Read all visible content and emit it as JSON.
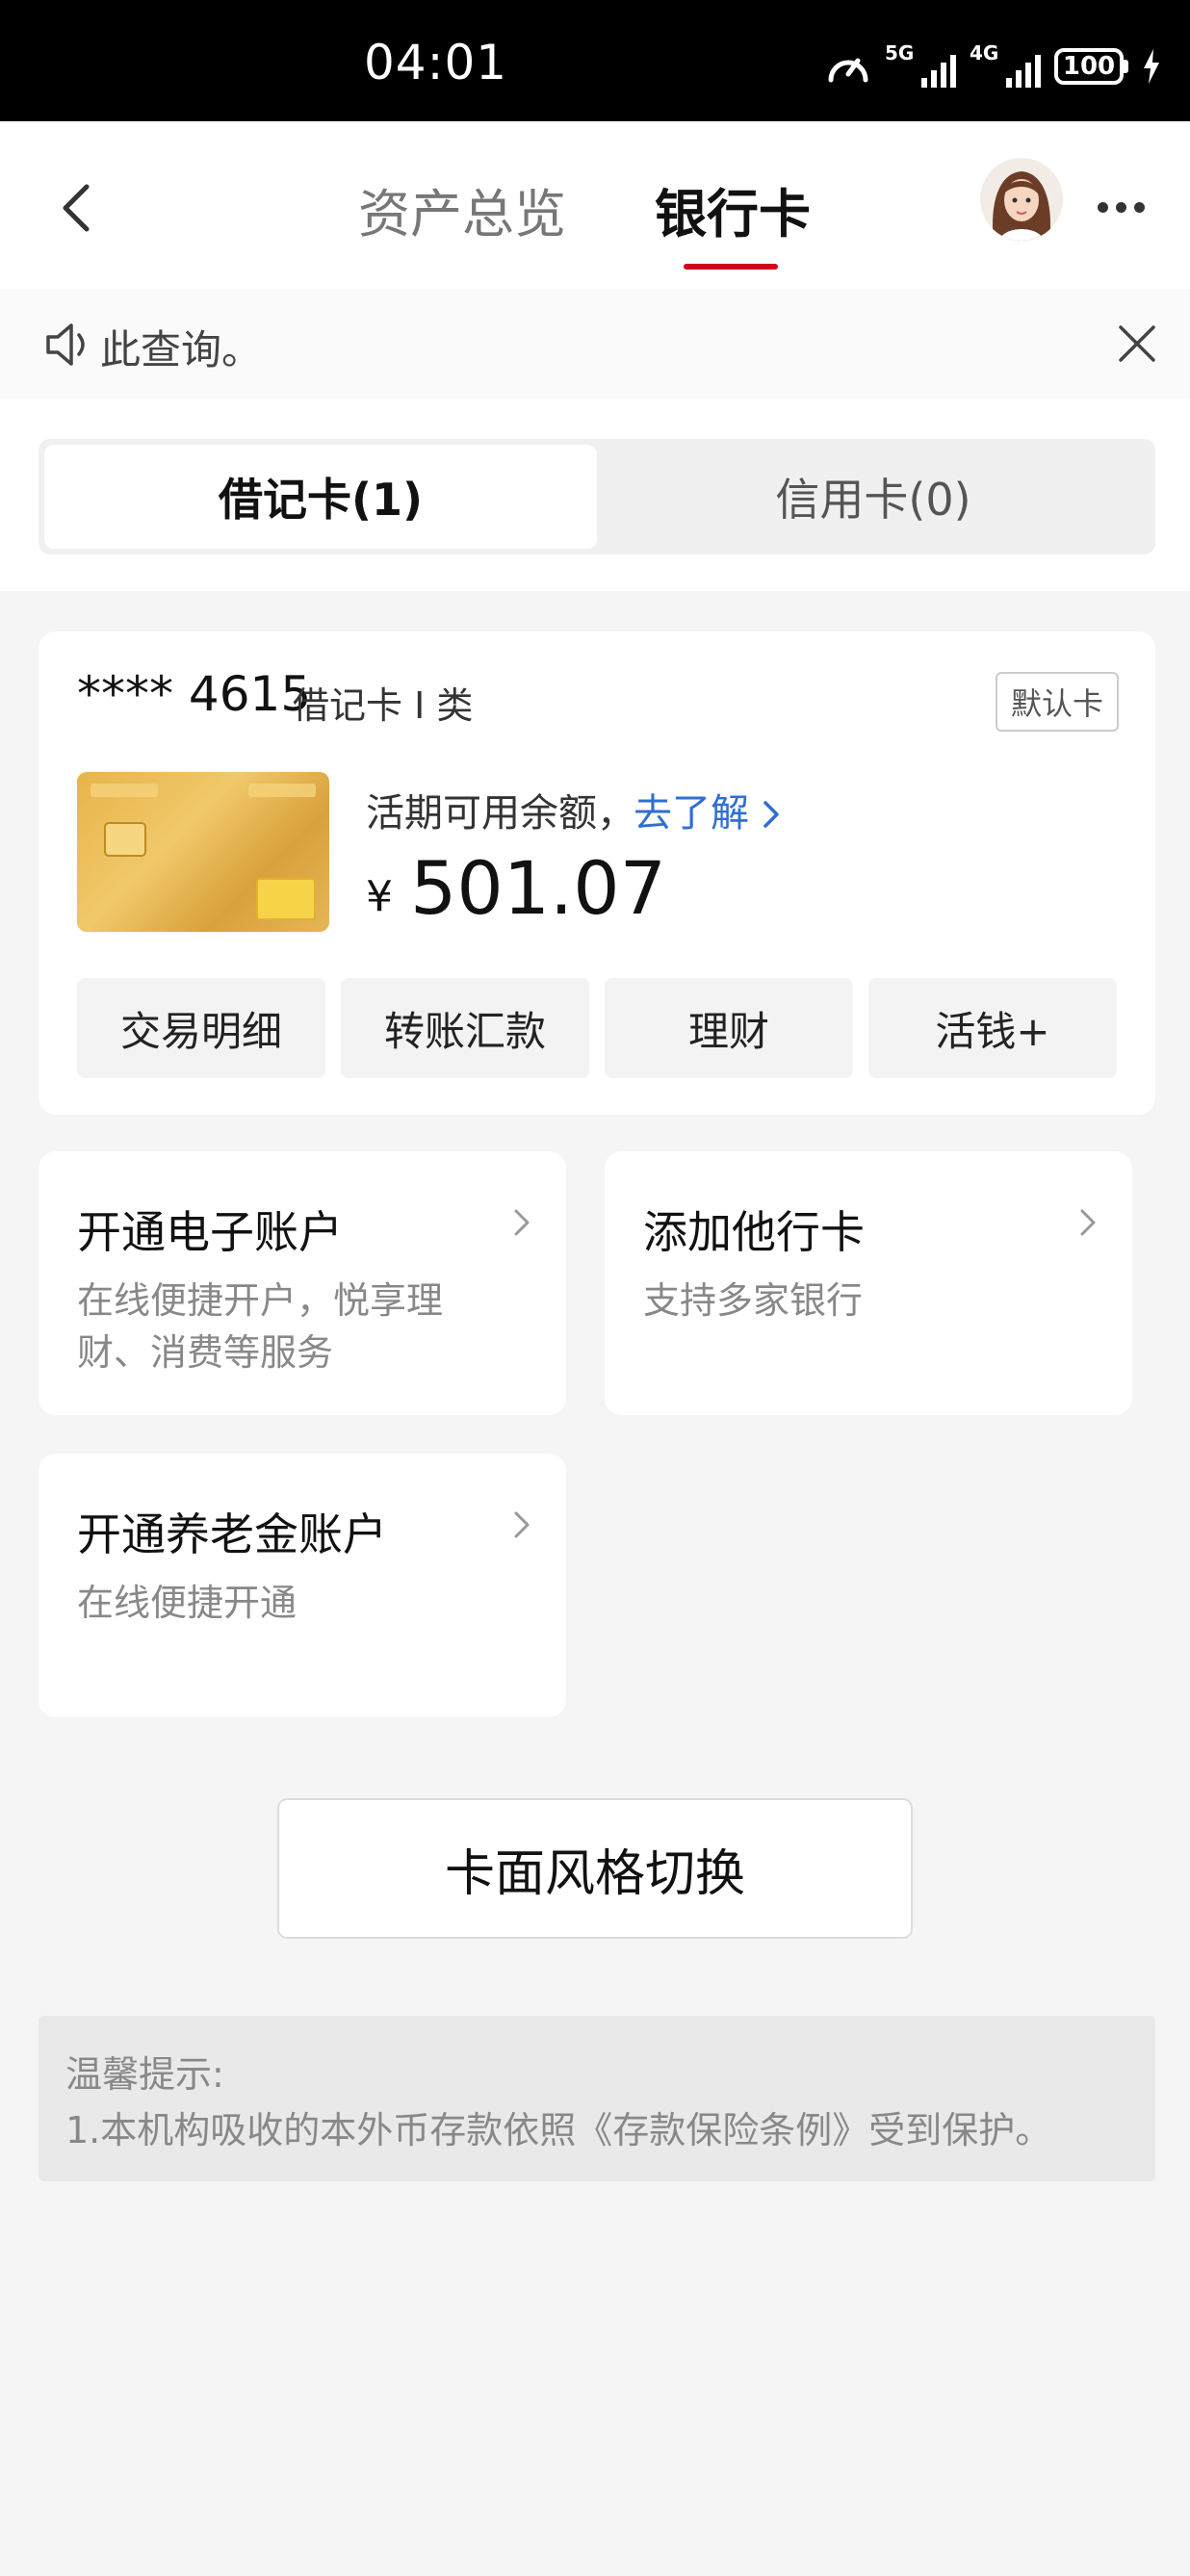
{
  "status_bar": {
    "time": "04:01",
    "sim1": "5G",
    "sim2": "4G",
    "battery": "100"
  },
  "header": {
    "tab_assets": "资产总览",
    "tab_bank": "银行卡",
    "accent": "#d0021b"
  },
  "notice": {
    "text": "此查询。"
  },
  "card_types": {
    "debit": "借记卡(1)",
    "credit": "信用卡(0)"
  },
  "card": {
    "number": "**** 4615",
    "type": "借记卡 I 类",
    "default_badge": "默认卡",
    "balance_label": "活期可用余额，",
    "learn_more": "去了解",
    "currency": "¥",
    "amount": "501.07",
    "actions": [
      "交易明细",
      "转账汇款",
      "理财",
      "活钱+"
    ]
  },
  "tiles": {
    "e_account": {
      "title": "开通电子账户",
      "sub": "在线便捷开户，悦享理财、消费等服务"
    },
    "add_card": {
      "title": "添加他行卡",
      "sub": "支持多家银行"
    },
    "pension": {
      "title": "开通养老金账户",
      "sub": "在线便捷开通"
    }
  },
  "style_switch": "卡面风格切换",
  "tips": {
    "title": "温馨提示:",
    "line1": "1.本机构吸收的本外币存款依照《存款保险条例》受到保护。"
  }
}
